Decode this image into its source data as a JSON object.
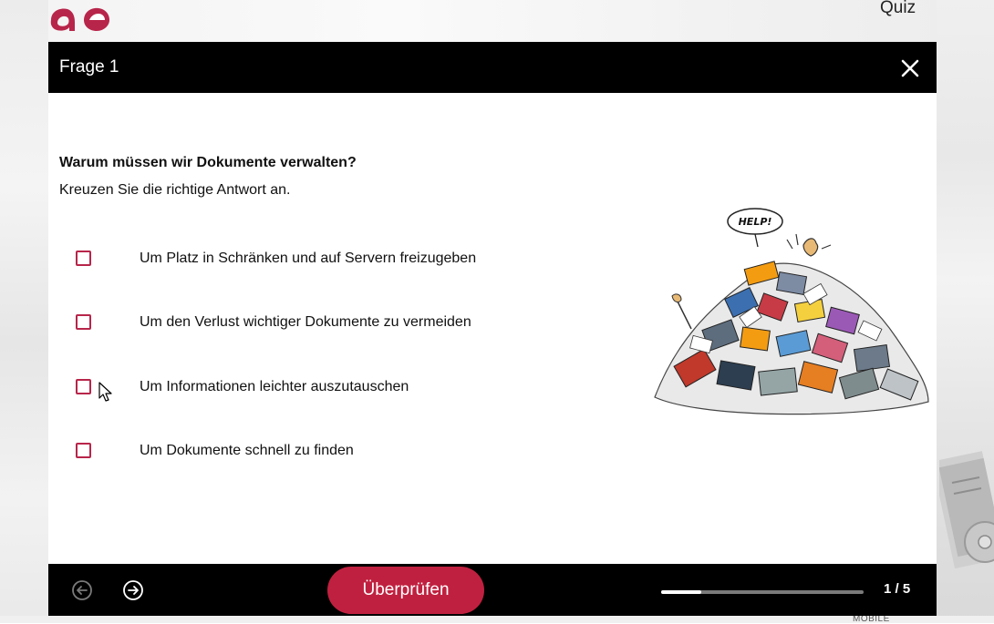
{
  "brand": {
    "accent": "#c0203f",
    "logo_color": "#b8254a"
  },
  "top": {
    "link": "Quiz"
  },
  "modal": {
    "title": "Frage 1",
    "question": "Warum müssen wir Dokumente verwalten?",
    "instruction": "Kreuzen Sie die richtige Antwort an.",
    "options": [
      {
        "label": "Um Platz in Schränken und auf Servern freizugeben",
        "checked": false
      },
      {
        "label": "Um den Verlust wichtiger Dokumente zu vermeiden",
        "checked": false
      },
      {
        "label": "Um Informationen leichter auszutauschen",
        "checked": false
      },
      {
        "label": "Um Dokumente schnell zu finden",
        "checked": false
      }
    ],
    "illustration": {
      "speech": "HELP!"
    },
    "footer": {
      "check_label": "Überprüfen",
      "progress_text": "1 / 5",
      "progress_fraction": 0.2
    }
  },
  "icons": {
    "close": "close-icon",
    "prev": "arrow-left-circle-icon",
    "next": "arrow-right-circle-icon"
  }
}
